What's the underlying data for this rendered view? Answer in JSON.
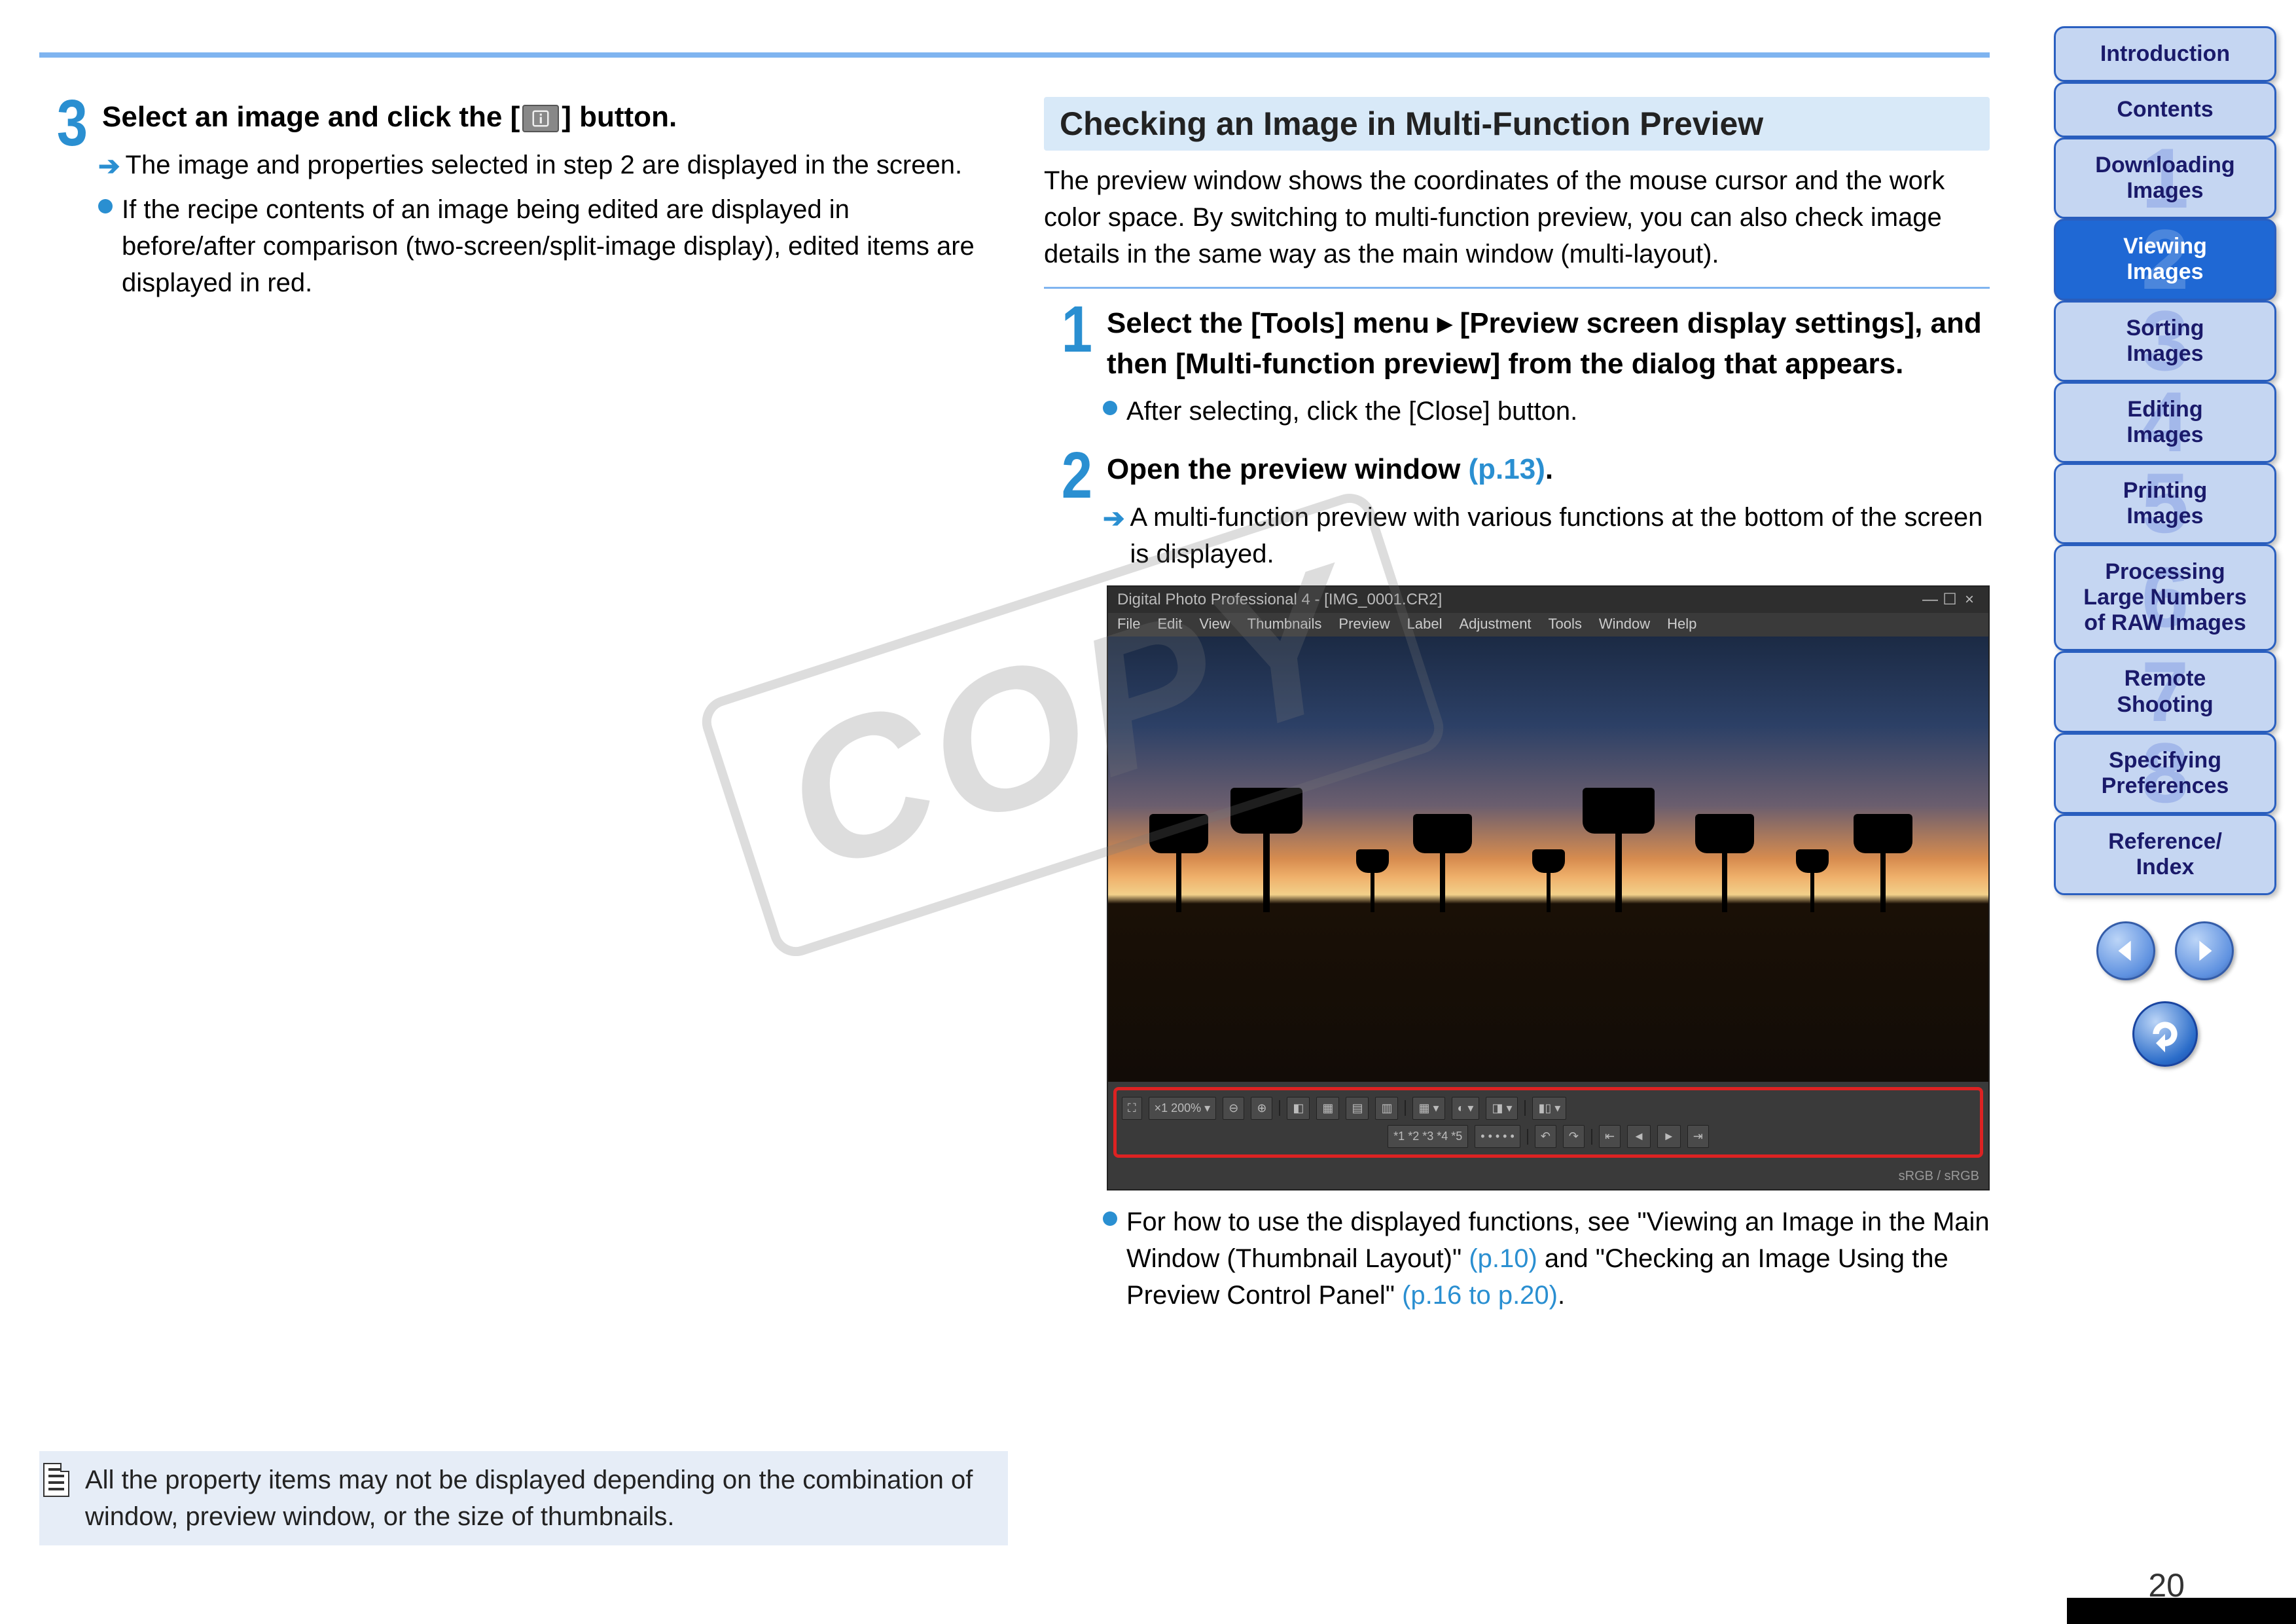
{
  "left": {
    "step3": {
      "number": "3",
      "title_prefix": "Select an image and click the [",
      "title_suffix": "] button.",
      "arrow_text": "The image and properties selected in step 2 are displayed in the screen.",
      "bullet_text": "If the recipe contents of an image being edited are displayed in before/after comparison (two-screen/split-image display), edited items are displayed in red."
    },
    "note": "All the property items may not be displayed depending on the combination of window, preview window, or the size of thumbnails."
  },
  "right": {
    "heading": "Checking an Image in Multi-Function Preview",
    "intro": "The preview window shows the coordinates of the mouse cursor and the work color space. By switching to multi-function preview, you can also check image details in the same way as the main window (multi-layout).",
    "step1": {
      "number": "1",
      "title": "Select the [Tools] menu ▸ [Preview screen display settings], and then [Multi-function preview] from the dialog that appears.",
      "bullet": "After selecting, click the [Close] button."
    },
    "step2": {
      "number": "2",
      "title_prefix": "Open the preview window ",
      "title_link": "(p.13)",
      "title_suffix": ".",
      "arrow": "A multi-function preview with various functions at the bottom of the screen is displayed.",
      "footer_pre": "For how to use the displayed functions, see \"Viewing an Image in the Main Window (Thumbnail Layout)\" ",
      "footer_link1": "(p.10)",
      "footer_mid": " and \"Checking an Image Using the Preview Control Panel\" ",
      "footer_link2": "(p.16 to p.20)",
      "footer_end": "."
    },
    "app": {
      "title": "Digital Photo Professional 4 - [IMG_0001.CR2]",
      "menus": [
        "File",
        "Edit",
        "View",
        "Thumbnails",
        "Preview",
        "Label",
        "Adjustment",
        "Tools",
        "Window",
        "Help"
      ],
      "zoom": "×1  200% ▾",
      "status": "sRGB / sRGB",
      "ratings": "*1 *2 *3 *4 *5"
    }
  },
  "sidebar": [
    {
      "label": "Introduction",
      "num": ""
    },
    {
      "label": "Contents",
      "num": ""
    },
    {
      "label": "Downloading\nImages",
      "num": "1"
    },
    {
      "label": "Viewing\nImages",
      "num": "2",
      "active": true
    },
    {
      "label": "Sorting\nImages",
      "num": "3"
    },
    {
      "label": "Editing\nImages",
      "num": "4"
    },
    {
      "label": "Printing\nImages",
      "num": "5"
    },
    {
      "label": "Processing\nLarge Numbers\nof RAW Images",
      "num": "6"
    },
    {
      "label": "Remote\nShooting",
      "num": "7"
    },
    {
      "label": "Specifying\nPreferences",
      "num": "8"
    },
    {
      "label": "Reference/\nIndex",
      "num": ""
    }
  ],
  "watermark": "COPY",
  "page_number": "20"
}
